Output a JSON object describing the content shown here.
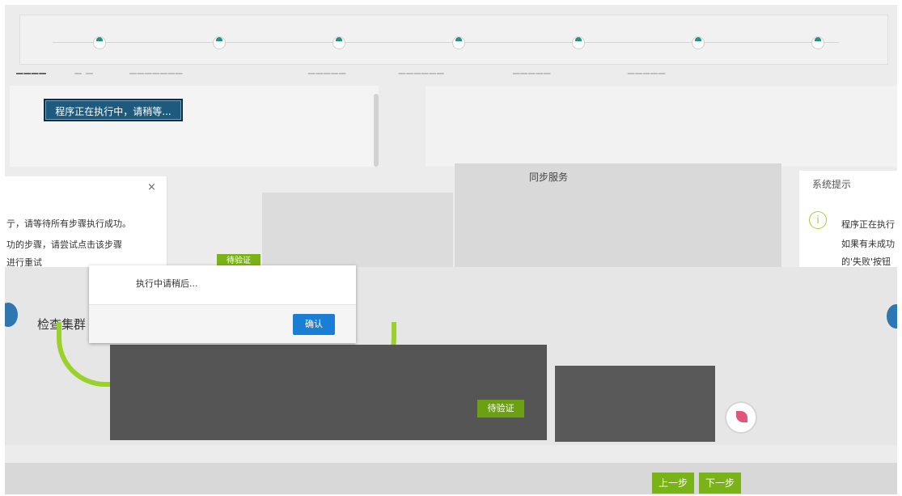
{
  "steps": {
    "count": 7,
    "label_fragments": [
      "▁▁▁▁",
      "▁ ▁",
      "▁▁▁▁▁▁▁",
      "▁▁▁▁▁",
      "▁▁▁▁▁▁",
      "▁▁▁▁▁",
      "▁▁▁▁▁"
    ]
  },
  "running_button": {
    "label": "程序正在执行中，请稍等..."
  },
  "left_dialog": {
    "close_label": "×",
    "lines": [
      "亍，请等待所有步骤执行成功。",
      "功的步骤，请尝试点击该步骤",
      "进行重试"
    ]
  },
  "right_dialog": {
    "title": "系统提示",
    "info_glyph": "i",
    "lines": [
      "程序正在执行",
      "如果有未成功",
      "的'失败'按钮"
    ]
  },
  "center": {
    "title": "同步服务"
  },
  "green_tag": {
    "label": "待验证"
  },
  "modal": {
    "message": "执行中请稍后...",
    "ok_label": "确认"
  },
  "check_label": "检查集群",
  "verify_button": {
    "label": "待验证"
  },
  "nav": {
    "prev_label": "上一步",
    "next_label": "下一步"
  },
  "colors": {
    "accent_green": "#7ab317",
    "accent_blue": "#1a7fd4",
    "running_blue": "#1e5a7e",
    "step_teal": "#2a8f84"
  }
}
